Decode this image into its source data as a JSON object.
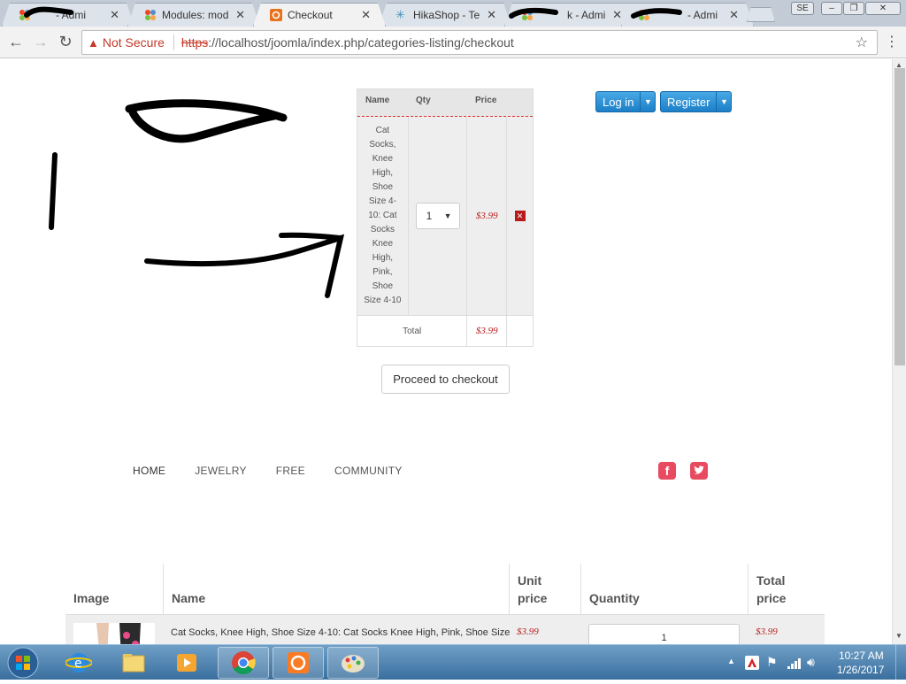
{
  "browser": {
    "tabs": [
      {
        "title": "- Admi"
      },
      {
        "title": "Modules: mod"
      },
      {
        "title": "Checkout"
      },
      {
        "title": "HikaShop - Te"
      },
      {
        "title": "k - Admi"
      },
      {
        "title": "- Admi"
      }
    ],
    "profile_badge": "SE",
    "address": {
      "security_label": "Not Secure",
      "scheme": "https",
      "url_rest": "://localhost/joomla/index.php/categories-listing/checkout"
    }
  },
  "minicart": {
    "headers": {
      "name": "Name",
      "qty": "Qty",
      "price": "Price"
    },
    "item": {
      "name": "Cat Socks, Knee High, Shoe Size 4-10: Cat Socks Knee High, Pink, Shoe Size 4-10",
      "qty": "1",
      "price": "$3.99"
    },
    "total_label": "Total",
    "total_value": "$3.99",
    "checkout_label": "Proceed to checkout"
  },
  "user_buttons": {
    "login": "Log in",
    "register": "Register"
  },
  "menu": [
    "HOME",
    "JEWELRY",
    "FREE",
    "COMMUNITY"
  ],
  "cart_table": {
    "headers": {
      "image": "Image",
      "name": "Name",
      "unit_price": "Unit price",
      "quantity": "Quantity",
      "total_price": "Total price"
    },
    "row": {
      "name": "Cat Socks, Knee High, Shoe Size 4-10: Cat Socks Knee High, Pink, Shoe Size",
      "unit_price": "$3.99",
      "quantity": "1",
      "total_price": "$3.99"
    }
  },
  "taskbar": {
    "time": "10:27 AM",
    "date": "1/26/2017"
  },
  "colors": {
    "price_red": "#b71c1c",
    "button_blue": "#1c7fc7",
    "social_pink": "#e84a5f"
  },
  "icons": [
    "joomla-icon",
    "hikashop-icon",
    "back-icon",
    "forward-icon",
    "reload-icon",
    "warning-icon",
    "star-icon",
    "menu-icon",
    "facebook-icon",
    "twitter-icon"
  ]
}
